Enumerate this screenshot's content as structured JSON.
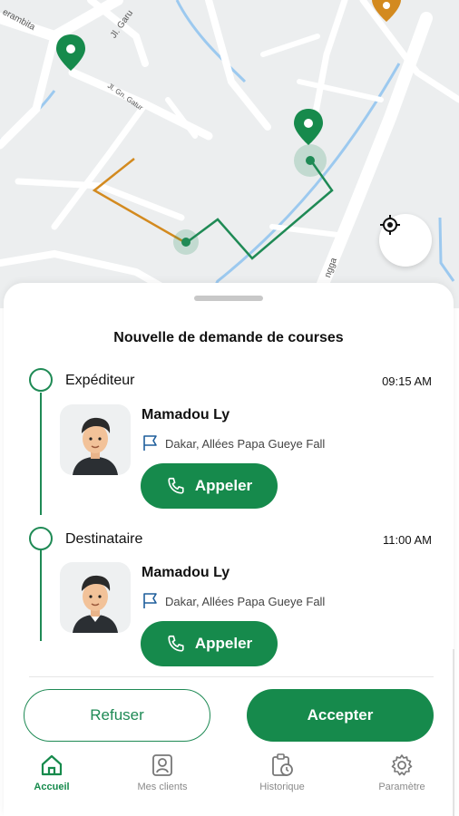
{
  "map": {
    "streets": [
      "erambita",
      "Jl. Garu",
      "Jl. Gn. Gatur",
      "ngga"
    ],
    "locate_icon": "crosshair-icon"
  },
  "sheet": {
    "title": "Nouvelle de demande de courses",
    "steps": [
      {
        "label": "Expéditeur",
        "time": "09:15 AM",
        "name": "Mamadou Ly",
        "address": "Dakar, Allées Papa Gueye Fall",
        "call_label": "Appeler"
      },
      {
        "label": "Destinataire",
        "time": "11:00 AM",
        "name": "Mamadou Ly",
        "address": "Dakar, Allées Papa Gueye Fall",
        "call_label": "Appeler"
      }
    ],
    "refuse_label": "Refuser",
    "accept_label": "Accepter"
  },
  "nav": {
    "items": [
      {
        "label": "Accueil",
        "icon": "home-icon",
        "active": true
      },
      {
        "label": "Mes clients",
        "icon": "contact-icon",
        "active": false
      },
      {
        "label": "Historique",
        "icon": "history-icon",
        "active": false
      },
      {
        "label": "Paramètre",
        "icon": "gear-icon",
        "active": false
      }
    ]
  },
  "colors": {
    "accent": "#168a4c",
    "route_green": "#1f8a55",
    "route_orange": "#d38a1f",
    "map_bg": "#eceeef",
    "water": "#9cc9ef"
  }
}
